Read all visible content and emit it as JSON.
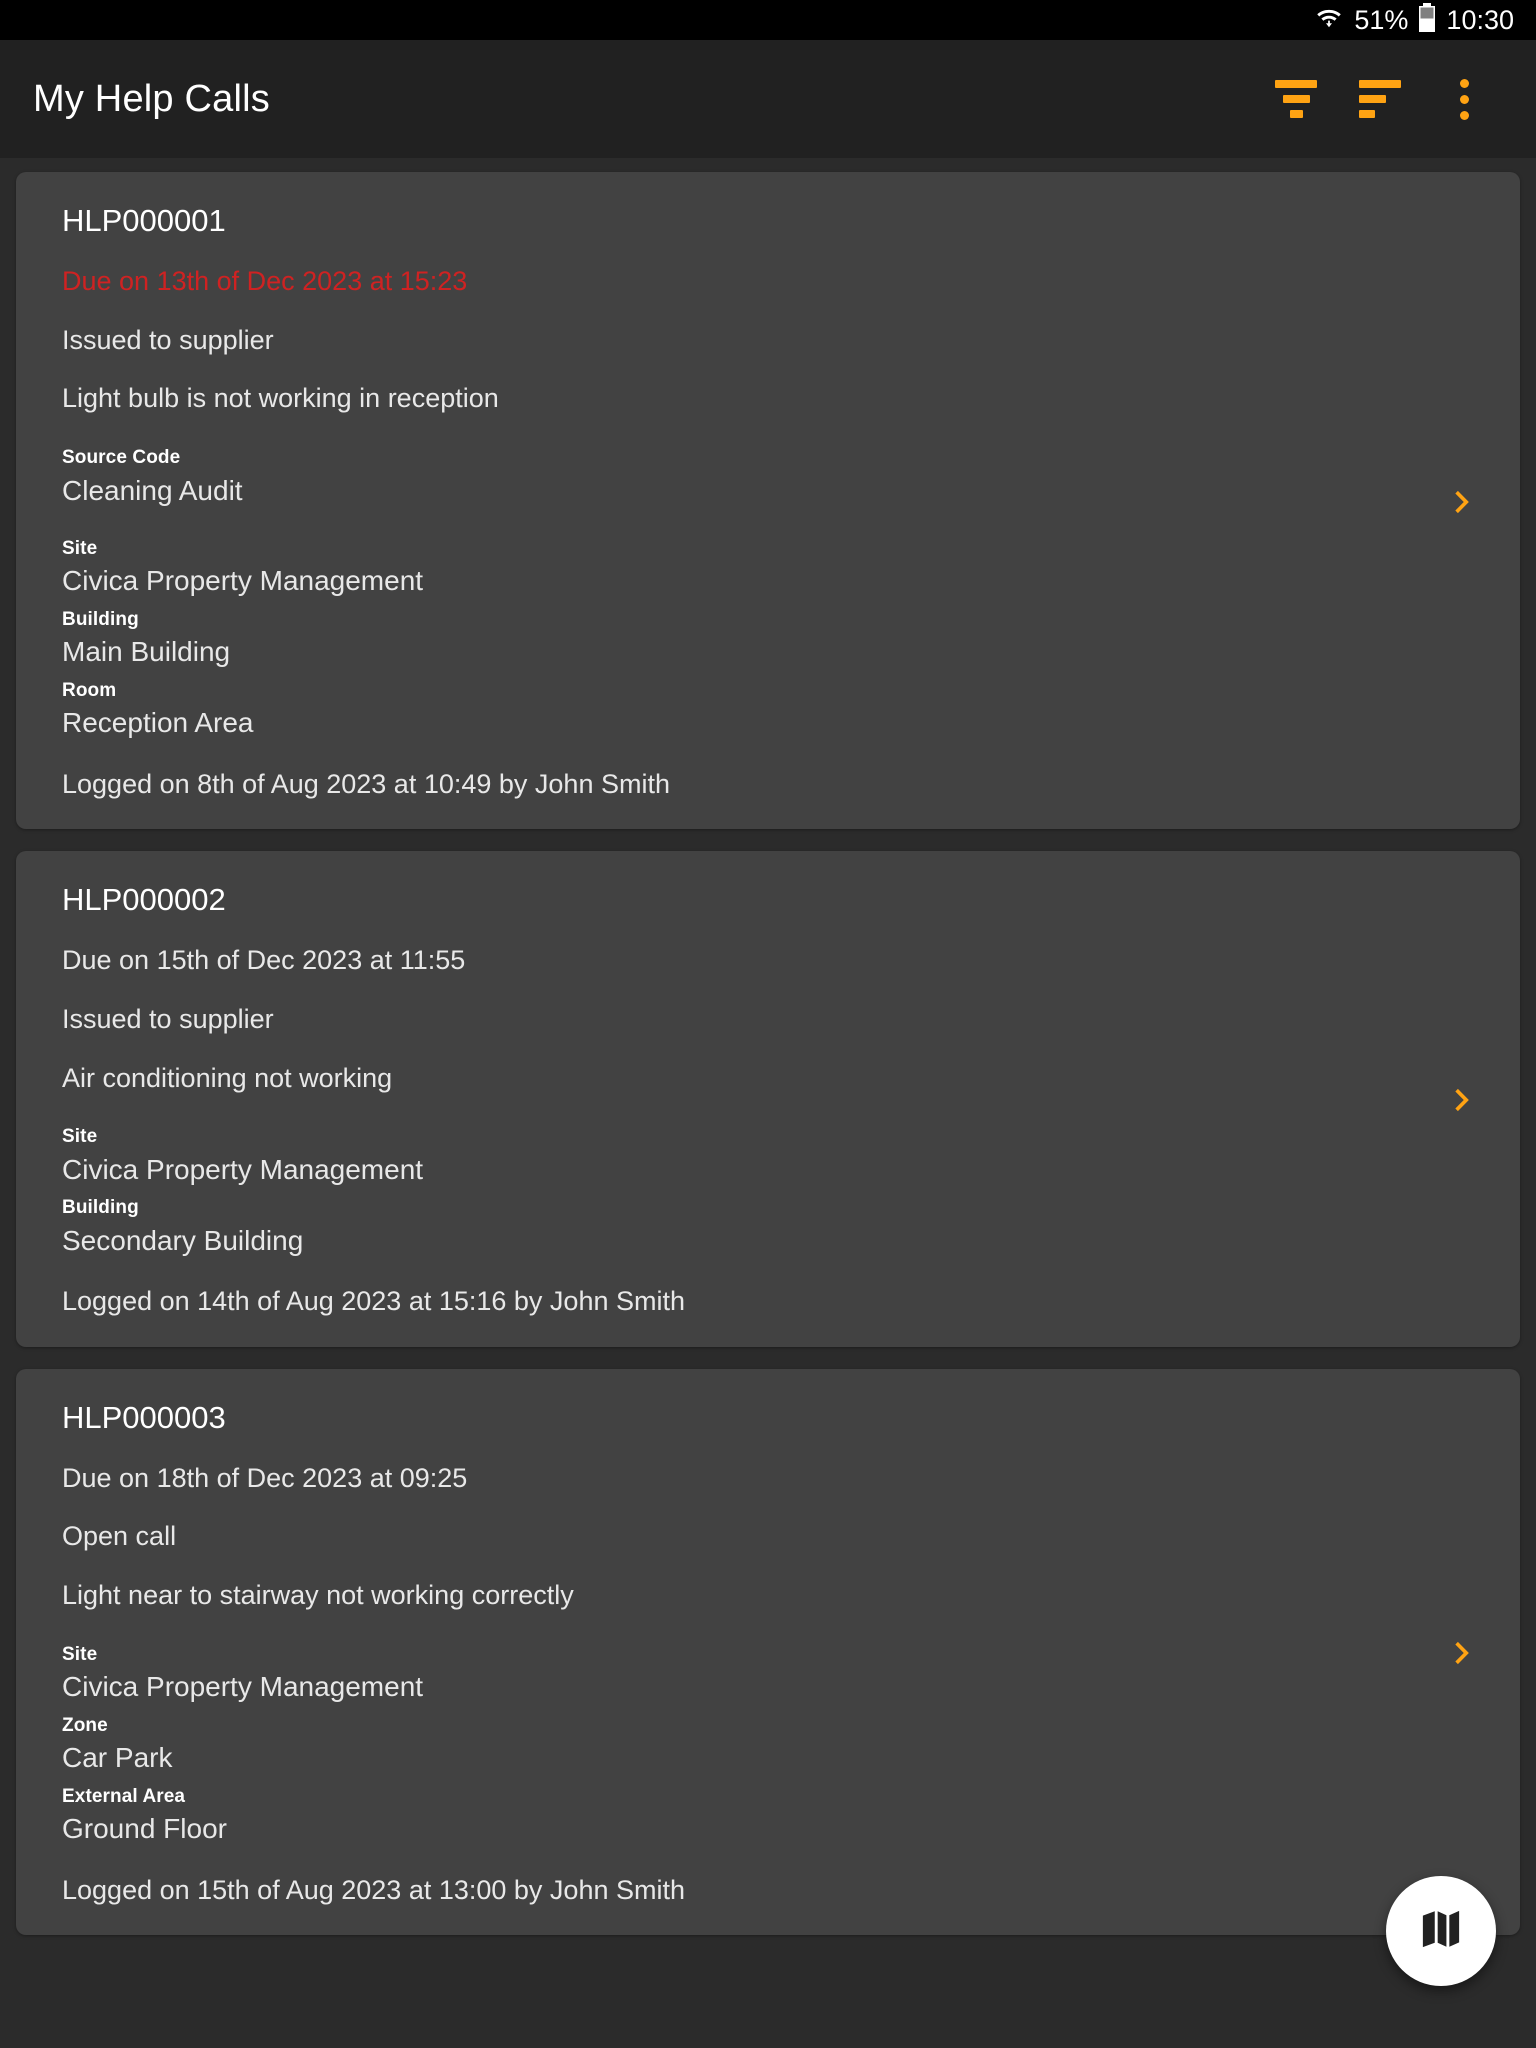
{
  "status_bar": {
    "wifi_icon": "wifi-icon",
    "battery_percent": "51%",
    "battery_icon": "battery-icon",
    "time": "10:30"
  },
  "app_bar": {
    "title": "My Help Calls",
    "actions": [
      {
        "name": "filter-icon",
        "label": "Filter"
      },
      {
        "name": "sort-icon",
        "label": "Sort"
      },
      {
        "name": "overflow-menu-icon",
        "label": "More options"
      }
    ]
  },
  "colors": {
    "accent": "#FFA313",
    "overdue": "#cf2222",
    "card_bg": "#424242",
    "page_bg": "#2b2b2b",
    "app_bar_bg": "#212121",
    "status_bar_bg": "#000000"
  },
  "fab": {
    "icon": "map-icon",
    "label": "Map view"
  },
  "cards": [
    {
      "ref": "HLP000001",
      "due": "Due on 13th of Dec 2023 at 15:23",
      "overdue": true,
      "status": "Issued to supplier",
      "description": "Light bulb is not working in reception",
      "fields": [
        {
          "label": "Source Code",
          "value": "Cleaning Audit",
          "spaced": true
        },
        {
          "label": "Site",
          "value": "Civica Property Management",
          "spaced": false
        },
        {
          "label": "Building",
          "value": "Main Building",
          "spaced": false
        },
        {
          "label": "Room",
          "value": "Reception Area",
          "spaced": false
        }
      ],
      "logged": "Logged on 8th of Aug 2023 at 10:49 by John Smith",
      "chevron": "chevron-right-icon"
    },
    {
      "ref": "HLP000002",
      "due": "Due on 15th of Dec 2023 at 11:55",
      "overdue": false,
      "status": "Issued to supplier",
      "description": "Air conditioning not working",
      "fields": [
        {
          "label": "Site",
          "value": "Civica Property Management",
          "spaced": false
        },
        {
          "label": "Building",
          "value": "Secondary Building",
          "spaced": false
        }
      ],
      "logged": "Logged on 14th of Aug 2023 at 15:16 by John Smith",
      "chevron": "chevron-right-icon"
    },
    {
      "ref": "HLP000003",
      "due": "Due on 18th of Dec 2023 at 09:25",
      "overdue": false,
      "status": "Open call",
      "description": "Light near to stairway not working correctly",
      "fields": [
        {
          "label": "Site",
          "value": "Civica Property Management",
          "spaced": false
        },
        {
          "label": "Zone",
          "value": "Car Park",
          "spaced": false
        },
        {
          "label": "External Area",
          "value": "Ground Floor",
          "spaced": false
        }
      ],
      "logged": "Logged on 15th of Aug 2023 at 13:00 by John Smith",
      "chevron": "chevron-right-icon"
    }
  ]
}
